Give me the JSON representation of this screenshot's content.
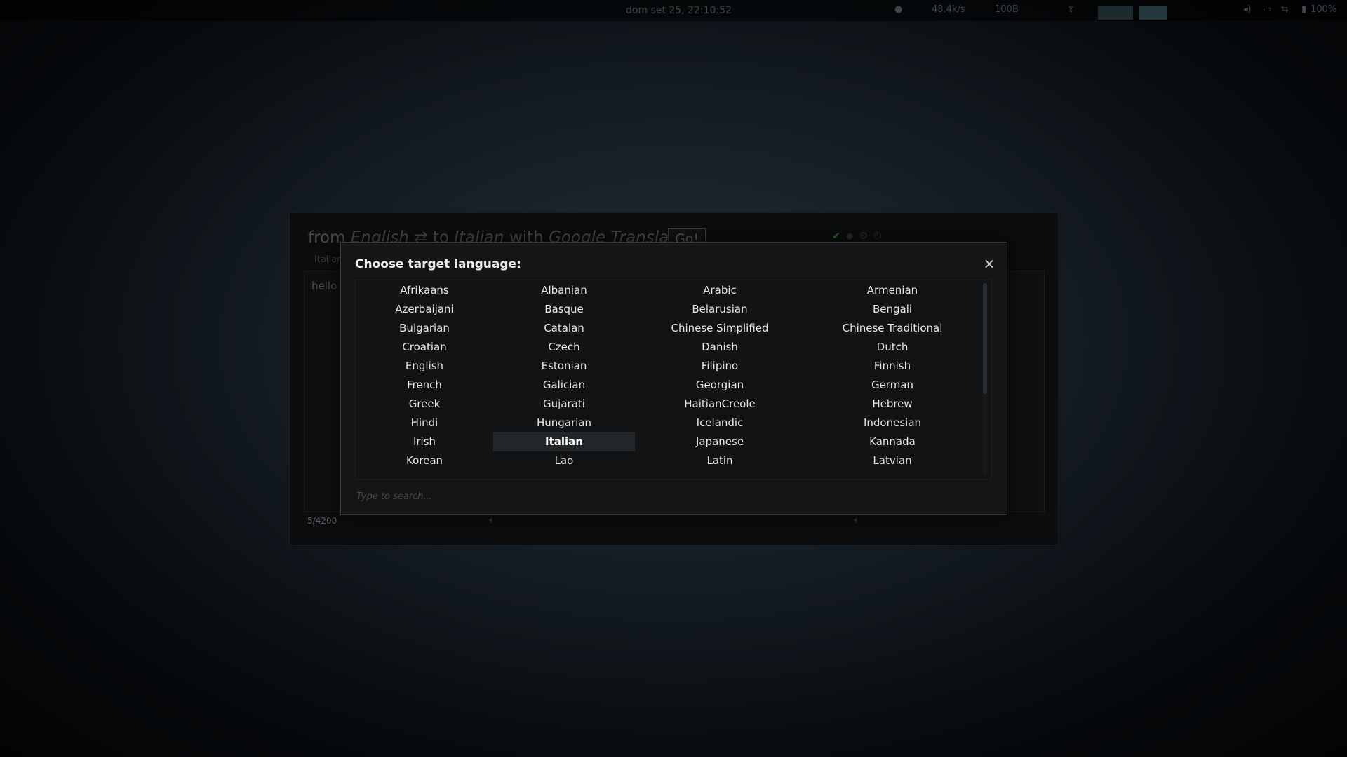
{
  "top_panel": {
    "clock": "dom set 25, 22:10:52",
    "net_down": "48.4k/s",
    "net_up": "100B",
    "battery": "100%"
  },
  "app": {
    "title_from": "from",
    "source_lang": "English",
    "swap_icon": "⇄",
    "title_to": "to",
    "target_lang": "Italian",
    "title_with": "with",
    "engine": "Google Translate",
    "go_label": "Go!",
    "source_tab": "Italian",
    "source_text": "hello",
    "char_count": "5/4200"
  },
  "modal": {
    "title": "Choose target language:",
    "close_label": "×",
    "search_placeholder": "Type to search...",
    "selected": "Italian",
    "rows": [
      [
        "Afrikaans",
        "Albanian",
        "Arabic",
        "Armenian"
      ],
      [
        "Azerbaijani",
        "Basque",
        "Belarusian",
        "Bengali"
      ],
      [
        "Bulgarian",
        "Catalan",
        "Chinese Simplified",
        "Chinese Traditional"
      ],
      [
        "Croatian",
        "Czech",
        "Danish",
        "Dutch"
      ],
      [
        "English",
        "Estonian",
        "Filipino",
        "Finnish"
      ],
      [
        "French",
        "Galician",
        "Georgian",
        "German"
      ],
      [
        "Greek",
        "Gujarati",
        "HaitianCreole",
        "Hebrew"
      ],
      [
        "Hindi",
        "Hungarian",
        "Icelandic",
        "Indonesian"
      ],
      [
        "Irish",
        "Italian",
        "Japanese",
        "Kannada"
      ],
      [
        "Korean",
        "Lao",
        "Latin",
        "Latvian"
      ]
    ]
  },
  "colors": {
    "status_ok": "#2c6a2a",
    "selected_bg": "#24272a",
    "modal_bg": "#141516"
  }
}
